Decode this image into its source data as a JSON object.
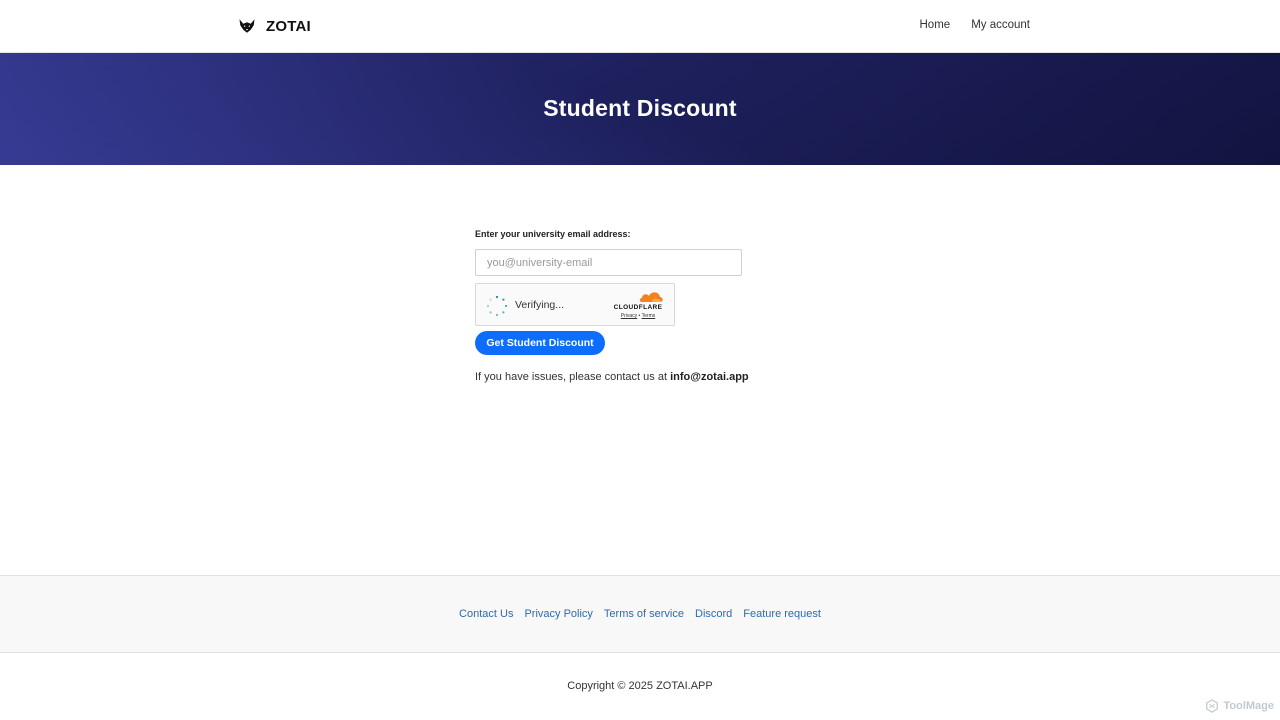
{
  "header": {
    "brand": "ZOTAI",
    "nav": [
      {
        "label": "Home"
      },
      {
        "label": "My account"
      }
    ]
  },
  "hero": {
    "title": "Student Discount"
  },
  "form": {
    "label": "Enter your university email address:",
    "email_placeholder": "you@university-email",
    "captcha": {
      "status": "Verifying...",
      "provider": "CLOUDFLARE",
      "privacy": "Privacy",
      "separator": "•",
      "terms": "Terms"
    },
    "submit_label": "Get Student Discount",
    "contact_text": "If you have issues, please contact us at",
    "contact_email": "info@zotai.app"
  },
  "footer": {
    "links": [
      {
        "label": "Contact Us"
      },
      {
        "label": "Privacy Policy"
      },
      {
        "label": "Terms of service"
      },
      {
        "label": "Discord"
      },
      {
        "label": "Feature request"
      }
    ],
    "copyright": "Copyright © 2025 ZOTAI.APP"
  },
  "watermark": "ToolMage",
  "colors": {
    "primary_button": "#0d6efd",
    "footer_link": "#2b6cb0",
    "hero_dark": "#10123c",
    "hero_light": "#3a3f9c",
    "cloudflare_orange": "#f48120",
    "spinner": "#1f8a9c"
  },
  "icons": {
    "brand": "fox-logo-icon",
    "captcha_spinner": "loading-spinner-icon",
    "cloudflare": "cloudflare-cloud-icon",
    "watermark": "toolmage-hexagon-icon"
  }
}
